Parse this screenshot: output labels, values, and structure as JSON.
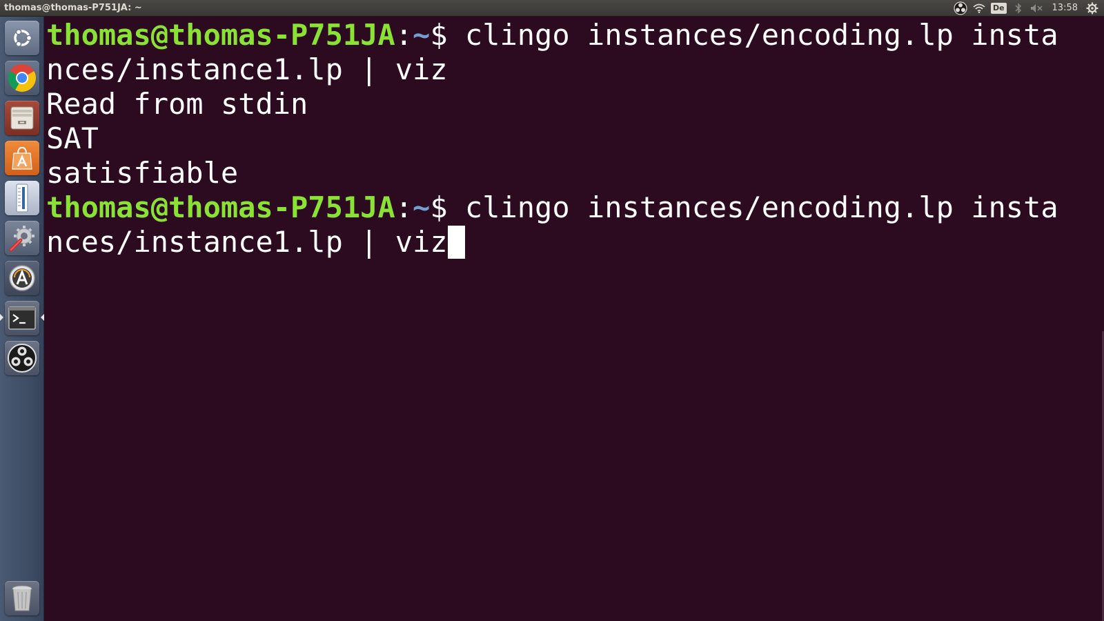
{
  "top_panel": {
    "window_title": "thomas@thomas-P751JA: ~",
    "keyboard_layout": "De",
    "clock": "13:58",
    "indicator_icons": [
      "obs-tray-icon",
      "wifi-icon",
      "keyboard-layout-icon",
      "bluetooth-icon",
      "volume-muted-icon",
      "session-gear-icon"
    ]
  },
  "launcher": {
    "items": [
      {
        "name": "dash-home",
        "icon": "ubuntu-logo-icon"
      },
      {
        "name": "chrome",
        "icon": "chrome-icon"
      },
      {
        "name": "files",
        "icon": "file-cabinet-icon"
      },
      {
        "name": "software-center",
        "icon": "shopping-bag-icon"
      },
      {
        "name": "text-editor",
        "icon": "thermometer-icon"
      },
      {
        "name": "system-settings",
        "icon": "wrench-gear-icon"
      },
      {
        "name": "software-updater",
        "icon": "updater-icon"
      },
      {
        "name": "terminal",
        "icon": "terminal-icon"
      },
      {
        "name": "obs",
        "icon": "obs-icon"
      },
      {
        "name": "trash",
        "icon": "trash-icon"
      }
    ]
  },
  "terminal": {
    "prompt": {
      "user_host": "thomas@thomas-P751JA",
      "separator": ":",
      "path": "~",
      "dollar": "$ "
    },
    "line1_command": "clingo instances/encoding.lp insta",
    "line2_text": "nces/instance1.lp | viz",
    "line3_text": "Read from stdin",
    "line4_text": "SAT",
    "line5_text": "satisfiable",
    "line6_command": "clingo instances/encoding.lp insta",
    "line7_text": "nces/instance1.lp | viz"
  },
  "colors": {
    "terminal_bg": "#2c0a1f",
    "prompt_user": "#8ae234",
    "prompt_path": "#729fcf",
    "text": "#ffffff"
  }
}
